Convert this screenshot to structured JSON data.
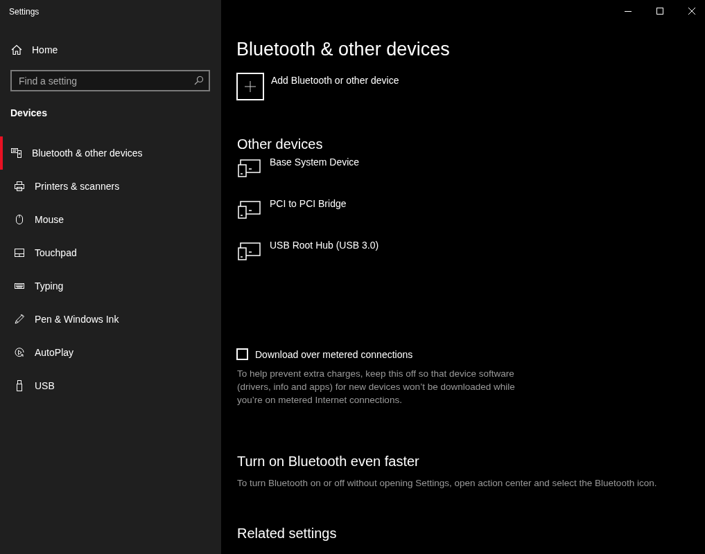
{
  "window": {
    "title": "Settings"
  },
  "sidebar": {
    "home": "Home",
    "search": {
      "placeholder": "Find a setting"
    },
    "section": "Devices",
    "items": [
      {
        "label": "Bluetooth & other devices",
        "kind": "bluetooth",
        "selected": true
      },
      {
        "label": "Printers & scanners",
        "kind": "printer",
        "selected": false
      },
      {
        "label": "Mouse",
        "kind": "mouse",
        "selected": false
      },
      {
        "label": "Touchpad",
        "kind": "touchpad",
        "selected": false
      },
      {
        "label": "Typing",
        "kind": "keyboard",
        "selected": false
      },
      {
        "label": "Pen & Windows Ink",
        "kind": "pen",
        "selected": false
      },
      {
        "label": "AutoPlay",
        "kind": "autoplay",
        "selected": false
      },
      {
        "label": "USB",
        "kind": "usb",
        "selected": false
      }
    ]
  },
  "main": {
    "heading": "Bluetooth & other devices",
    "add_button": "Add Bluetooth or other device",
    "other_devices": {
      "heading": "Other devices",
      "devices": [
        "Base System Device",
        "PCI to PCI Bridge",
        "USB Root Hub (USB 3.0)"
      ]
    },
    "metered": {
      "label": "Download over metered connections",
      "checked": false,
      "description": "To help prevent extra charges, keep this off so that device software (drivers, info and apps) for new devices won’t be downloaded while you’re on metered Internet connections."
    },
    "faster": {
      "heading": "Turn on Bluetooth even faster",
      "description": "To turn Bluetooth on or off without opening Settings, open action center and select the Bluetooth icon."
    },
    "related": {
      "heading": "Related settings"
    }
  }
}
